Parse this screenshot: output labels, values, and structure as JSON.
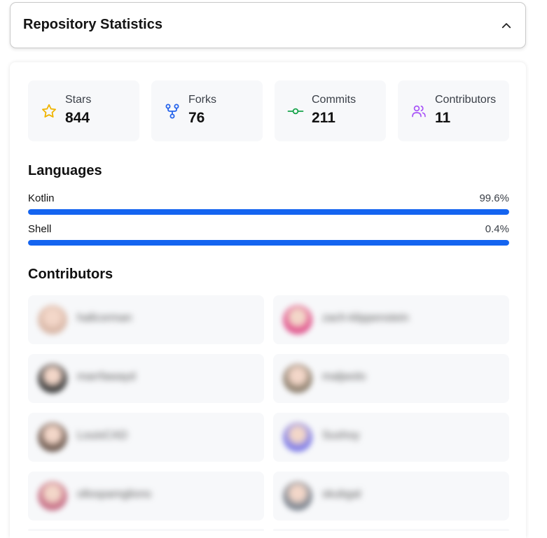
{
  "header": {
    "title": "Repository Statistics"
  },
  "stats": [
    {
      "label": "Stars",
      "value": "844",
      "icon": "star-icon",
      "color": "#f0b400"
    },
    {
      "label": "Forks",
      "value": "76",
      "icon": "fork-icon",
      "color": "#2563eb"
    },
    {
      "label": "Commits",
      "value": "211",
      "icon": "commit-icon",
      "color": "#16a34a"
    },
    {
      "label": "Contributors",
      "value": "11",
      "icon": "users-icon",
      "color": "#a855f7"
    }
  ],
  "languages": {
    "title": "Languages",
    "items": [
      {
        "name": "Kotlin",
        "percent_label": "99.6%",
        "fill_fraction": 1.0
      },
      {
        "name": "Shell",
        "percent_label": "0.4%",
        "fill_fraction": 1.0
      }
    ],
    "bar_color": "#1464f0"
  },
  "contributors": {
    "title": "Contributors",
    "items": [
      {
        "name": "hallcorman",
        "avatar_color": "#d9b8a8"
      },
      {
        "name": "zach-klippenstein",
        "avatar_color": "#e0568e"
      },
      {
        "name": "marrfawayd",
        "avatar_color": "#3a3a3a"
      },
      {
        "name": "maljwolo",
        "avatar_color": "#8f8170"
      },
      {
        "name": "LouisCAD",
        "avatar_color": "#6e5a50"
      },
      {
        "name": "Sushoy",
        "avatar_color": "#7e7ce8"
      },
      {
        "name": "ollospamglions",
        "avatar_color": "#c66f86"
      },
      {
        "name": "skubgal",
        "avatar_color": "#7d8590"
      }
    ]
  }
}
